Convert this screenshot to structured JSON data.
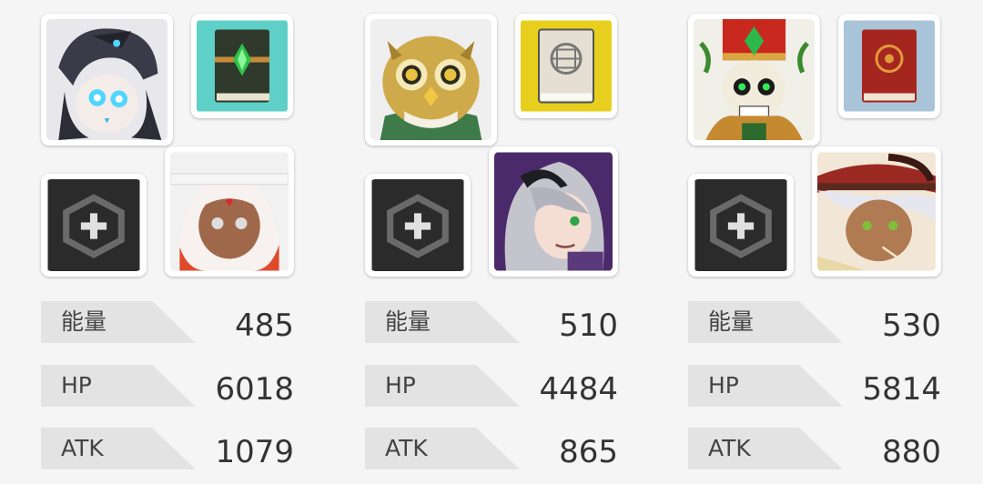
{
  "teams": [
    {
      "hero": "dark-armored-girl-portrait",
      "book": "green-gem-spellbook-icon",
      "support_slot": "add-slot-icon",
      "support": "white-haired-girl-portrait",
      "stats": [
        {
          "label": "能量",
          "value": "485"
        },
        {
          "label": "HP",
          "value": "6018"
        },
        {
          "label": "ATK",
          "value": "1079"
        }
      ]
    },
    {
      "hero": "owl-portrait",
      "book": "rune-spellbook-icon",
      "support_slot": "add-slot-icon",
      "support": "gray-haired-girl-portrait",
      "stats": [
        {
          "label": "能量",
          "value": "510"
        },
        {
          "label": "HP",
          "value": "4484"
        },
        {
          "label": "ATK",
          "value": "865"
        }
      ]
    },
    {
      "hero": "skull-king-portrait",
      "book": "red-spellbook-icon",
      "support_slot": "add-slot-icon",
      "support": "cowboy-hat-girl-portrait",
      "stats": [
        {
          "label": "能量",
          "value": "530"
        },
        {
          "label": "HP",
          "value": "5814"
        },
        {
          "label": "ATK",
          "value": "880"
        }
      ]
    }
  ],
  "colors": {
    "background": "#f5f5f5",
    "label_bg": "#e3e3e3",
    "slot_bg": "#2b2b2b"
  }
}
